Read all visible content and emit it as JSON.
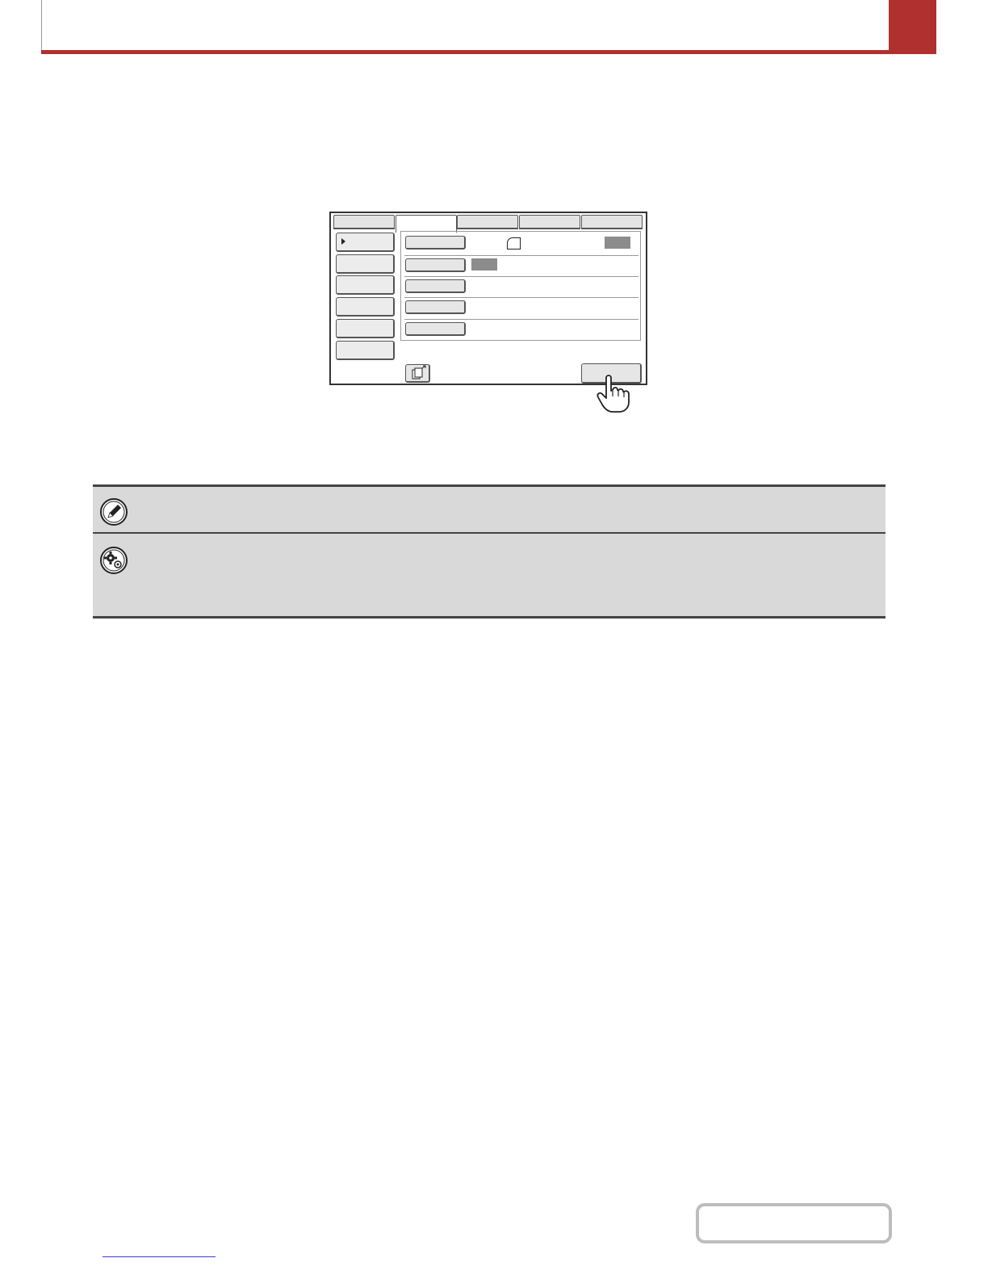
{
  "header": {
    "title": "",
    "page_number": "",
    "accent_color": "#b03030"
  },
  "panel": {
    "tabs": [
      "",
      "",
      "",
      "",
      ""
    ],
    "side_buttons": [
      "",
      "",
      "",
      "",
      "",
      ""
    ],
    "rows": [
      {
        "button": "",
        "value": ""
      },
      {
        "button": "",
        "value": ""
      },
      {
        "button": "",
        "value": ""
      },
      {
        "button": "",
        "value": ""
      },
      {
        "button": "",
        "value": ""
      }
    ],
    "ok_label": ""
  },
  "notes": {
    "note_text": "",
    "settings_text": ""
  },
  "footer": {
    "contents_label": "",
    "link_text": ""
  }
}
